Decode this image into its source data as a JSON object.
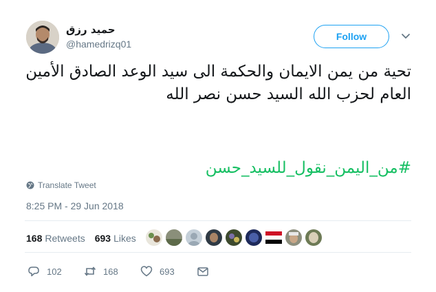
{
  "author": {
    "display_name": "حميد رزق",
    "handle": "@hamedrizq01"
  },
  "follow_label": "Follow",
  "tweet": {
    "text": "تحية من يمن الايمان والحكمة الى سيد الوعد الصادق الأمين العام لحزب الله السيد حسن نصر الله",
    "hashtag": "#من_اليمن_نقول_للسيد_حسن"
  },
  "translate_label": "Translate Tweet",
  "timestamp": "8:25 PM - 29 Jun 2018",
  "stats": {
    "retweets_count": "168",
    "retweets_label": "Retweets",
    "likes_count": "693",
    "likes_label": "Likes"
  },
  "actions": {
    "reply_count": "102",
    "retweet_count": "168",
    "like_count": "693"
  },
  "colors": {
    "accent": "#1da1f2",
    "hashtag": "#17bf63",
    "muted": "#657786"
  },
  "icons": [
    "chevron-down-icon",
    "globe-icon",
    "reply-icon",
    "retweet-icon",
    "heart-icon",
    "message-icon"
  ]
}
